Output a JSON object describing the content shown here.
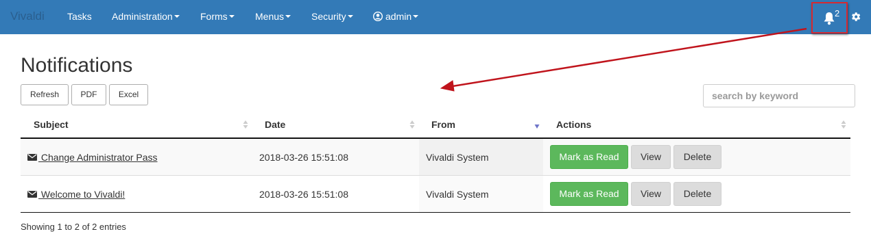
{
  "navbar": {
    "brand": "Vivaldi",
    "items": [
      {
        "label": "Tasks",
        "dropdown": false
      },
      {
        "label": "Administration",
        "dropdown": true
      },
      {
        "label": "Forms",
        "dropdown": true
      },
      {
        "label": "Menus",
        "dropdown": true
      },
      {
        "label": "Security",
        "dropdown": true
      }
    ],
    "user": {
      "label": "admin",
      "icon": "user-circle-icon"
    },
    "notifications": {
      "count": "2",
      "icon": "bell-icon"
    },
    "settings_icon": "gear-icon"
  },
  "page": {
    "title": "Notifications",
    "toolbar": {
      "refresh": "Refresh",
      "pdf": "PDF",
      "excel": "Excel"
    },
    "search": {
      "placeholder": "search by keyword",
      "value": ""
    }
  },
  "table": {
    "columns": [
      "Subject",
      "Date",
      "From",
      "Actions"
    ],
    "sorted_column": "From",
    "rows": [
      {
        "subject": " Change Administrator Pass",
        "date": "2018-03-26 15:51:08",
        "from": "Vivaldi System",
        "actions": [
          "Mark as Read",
          "View",
          "Delete"
        ]
      },
      {
        "subject": " Welcome to Vivaldi!",
        "date": "2018-03-26 15:51:08",
        "from": "Vivaldi System",
        "actions": [
          "Mark as Read",
          "View",
          "Delete"
        ]
      }
    ],
    "info": "Showing 1 to 2 of 2 entries"
  },
  "colors": {
    "navbar": "#337ab7",
    "success": "#5cb85c",
    "annotation": "#c0141c"
  }
}
